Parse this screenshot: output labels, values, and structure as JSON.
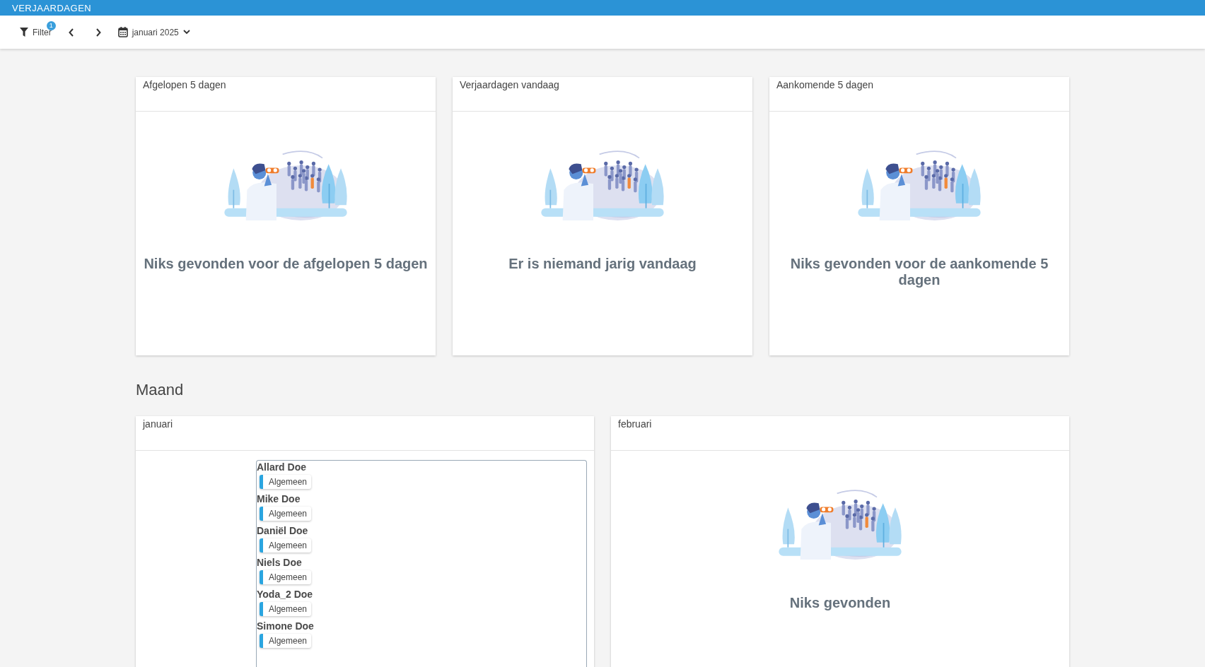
{
  "app_title": "VERJAARDAGEN",
  "toolbar": {
    "filter": {
      "label": "Filter",
      "badge": "1"
    },
    "period": {
      "label": "januari 2025"
    }
  },
  "summary_cards": [
    {
      "title": "Afgelopen 5 dagen",
      "empty_message": "Niks gevonden voor de afgelopen 5 dagen"
    },
    {
      "title": "Verjaardagen vandaag",
      "empty_message": "Er is niemand jarig vandaag"
    },
    {
      "title": "Aankomende 5 dagen",
      "empty_message": "Niks gevonden voor de aankomende 5 dagen"
    }
  ],
  "month_section": {
    "heading": "Maand",
    "months": [
      {
        "title": "januari",
        "people": [
          {
            "name": "Allard Doe",
            "tag": "Algemeen"
          },
          {
            "name": "Mike Doe",
            "tag": "Algemeen"
          },
          {
            "name": "Daniël Doe",
            "tag": "Algemeen"
          },
          {
            "name": "Niels Doe",
            "tag": "Algemeen"
          },
          {
            "name": "Yoda_2 Doe",
            "tag": "Algemeen"
          },
          {
            "name": "Simone Doe",
            "tag": "Algemeen"
          }
        ]
      },
      {
        "title": "februari",
        "empty_message": "Niks gevonden"
      }
    ]
  }
}
